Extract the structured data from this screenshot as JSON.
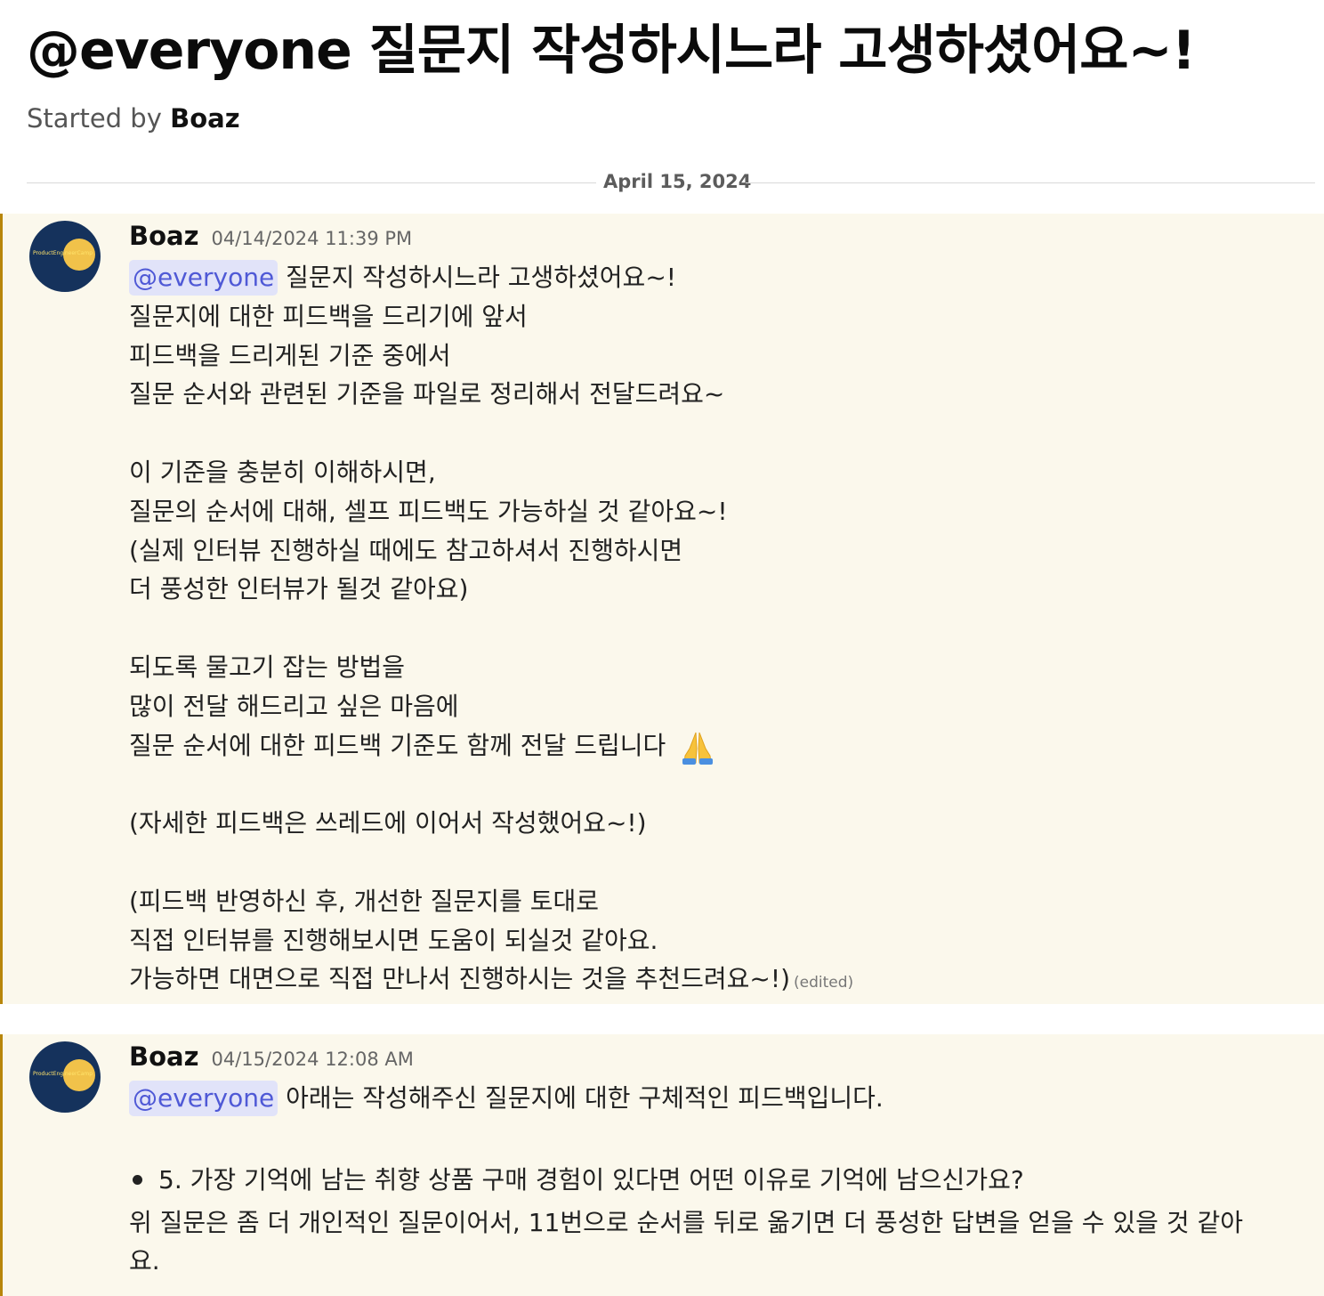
{
  "thread": {
    "title": "@everyone 질문지 작성하시느라 고생하셨어요~!",
    "started_by_prefix": "Started by ",
    "started_by_author": "Boaz"
  },
  "date_divider": "April 15, 2024",
  "messages": [
    {
      "author": "Boaz",
      "timestamp": "04/14/2024 11:39 PM",
      "avatar_text": "ProductEngineerCamp",
      "mention": "@everyone",
      "first_line_rest": " 질문지 작성하시느라 고생하셨어요~!",
      "lines": [
        "질문지에 대한 피드백을 드리기에 앞서",
        "피드백을 드리게된 기준 중에서",
        "질문 순서와 관련된 기준을 파일로 정리해서 전달드려요~",
        "",
        "이 기준을 충분히 이해하시면,",
        "질문의 순서에 대해, 셀프 피드백도 가능하실 것 같아요~!",
        "(실제 인터뷰 진행하실 때에도 참고하셔서 진행하시면",
        "더 풍성한 인터뷰가 될것 같아요)",
        "",
        "되도록 물고기 잡는 방법을",
        "많이 전달 해드리고 싶은 마음에",
        "질문 순서에 대한 피드백 기준도 함께 전달 드립니다",
        "",
        "(자세한 피드백은 쓰레드에 이어서 작성했어요~!)",
        "",
        "(피드백 반영하신 후, 개선한 질문지를 토대로",
        "직접 인터뷰를 진행해보시면 도움이 되실것 같아요.",
        "가능하면 대면으로 직접 만나서 진행하시는 것을 추천드려요~!)"
      ],
      "emoji_icon": "folded-hands-icon",
      "edited_label": "(edited)"
    },
    {
      "author": "Boaz",
      "timestamp": "04/15/2024 12:08 AM",
      "avatar_text": "ProductEngineerCamp",
      "mention": "@everyone",
      "first_line_rest": " 아래는 작성해주신 질문지에 대한 구체적인 피드백입니다.",
      "bullet": "5. 가장 기억에 남는 취향 상품 구매 경험이 있다면 어떤 이유로 기억에 남으신가요?",
      "paragraph": "위 질문은 좀 더 개인적인 질문이어서, 11번으로 순서를 뒤로 옮기면 더 풍성한 답변을 얻을 수 있을 것 같아요."
    }
  ],
  "colors": {
    "message_bg": "#fbf8ec",
    "accent_bar": "#b8860b",
    "mention_bg": "#e1e3f9",
    "mention_text": "#4f59d6"
  }
}
